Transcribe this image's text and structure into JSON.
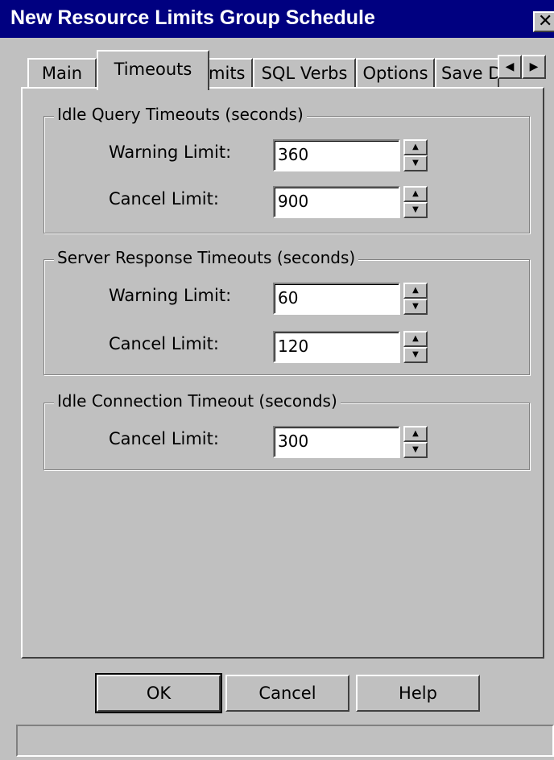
{
  "window": {
    "title": "New Resource Limits Group Schedule",
    "close_glyph": "✕"
  },
  "tabs": [
    {
      "label": "Main",
      "active": false
    },
    {
      "label": "Timeouts",
      "active": true
    },
    {
      "label": "Limits",
      "active": false
    },
    {
      "label": "SQL Verbs",
      "active": false
    },
    {
      "label": "Options",
      "active": false
    },
    {
      "label": "Save D",
      "active": false
    }
  ],
  "tab_scroll": {
    "left_glyph": "◀",
    "right_glyph": "▶"
  },
  "groups": {
    "idle_query": {
      "title": "Idle Query Timeouts (seconds)",
      "warning_label": "Warning Limit:",
      "warning_value": "360",
      "cancel_label": "Cancel Limit:",
      "cancel_value": "900"
    },
    "server_response": {
      "title": "Server Response Timeouts (seconds)",
      "warning_label": "Warning Limit:",
      "warning_value": "60",
      "cancel_label": "Cancel Limit:",
      "cancel_value": "120"
    },
    "idle_connection": {
      "title": "Idle Connection Timeout (seconds)",
      "cancel_label": "Cancel Limit:",
      "cancel_value": "300"
    }
  },
  "spin_glyphs": {
    "up": "▲",
    "down": "▼"
  },
  "buttons": {
    "ok": "OK",
    "cancel": "Cancel",
    "help": "Help"
  },
  "status_text": ""
}
